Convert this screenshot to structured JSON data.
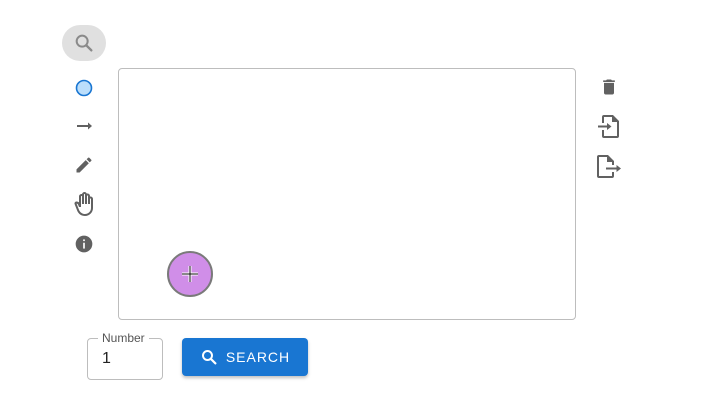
{
  "left_toolbar": {
    "tools": [
      {
        "name": "search",
        "icon": "search-icon",
        "active": true
      },
      {
        "name": "circle",
        "icon": "circle-icon"
      },
      {
        "name": "arrow",
        "icon": "arrow-right-icon"
      },
      {
        "name": "pencil",
        "icon": "pencil-icon"
      },
      {
        "name": "hand",
        "icon": "hand-icon"
      },
      {
        "name": "info",
        "icon": "info-icon"
      }
    ]
  },
  "right_toolbar": {
    "actions": [
      {
        "name": "delete",
        "icon": "trash-icon"
      },
      {
        "name": "import",
        "icon": "file-import-icon"
      },
      {
        "name": "export",
        "icon": "file-export-icon"
      }
    ]
  },
  "canvas": {
    "node": {
      "color": "#d08ee8",
      "border": "#7a7a7a"
    }
  },
  "form": {
    "number_label": "Number",
    "number_value": "1",
    "search_label": "SEARCH"
  },
  "colors": {
    "primary": "#1976d2",
    "icon_gray": "#616161",
    "circle_fill": "#bbdefb",
    "circle_stroke": "#1976d2"
  }
}
